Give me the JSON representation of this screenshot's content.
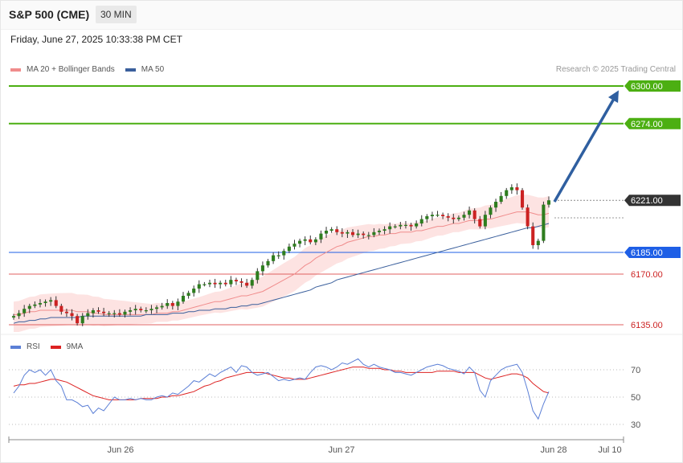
{
  "header": {
    "title": "S&P 500 (CME)",
    "interval": "30 MIN",
    "datetime": "Friday, June 27, 2025 10:33:38 PM CET"
  },
  "legend": {
    "ma20": "MA 20 + Bollinger Bands",
    "ma50": "MA 50",
    "credit": "Research © 2025 Trading Central"
  },
  "rsi_legend": {
    "rsi": "RSI",
    "ma9": "9MA"
  },
  "colors": {
    "candle_up": "#2e7d1f",
    "candle_down": "#cc2222",
    "ma20": "#f08c8c",
    "bollinger_fill": "#fde0df",
    "ma50": "#3a5f9c",
    "resistance": "#4caf12",
    "support_blue": "#1e5fe6",
    "support_red": "#e06060",
    "rsi": "#5b7fd6",
    "rsi_ma": "#dd2222",
    "arrow": "#2f5fa0"
  },
  "chart_data": [
    {
      "type": "candlestick",
      "x_labels": [
        "Jun 26",
        "Jun 27",
        "Jun 28",
        "Jul 10"
      ],
      "ylim": [
        6125,
        6315
      ],
      "levels": [
        {
          "value": 6300.0,
          "label": "6300.00",
          "kind": "resistance"
        },
        {
          "value": 6274.0,
          "label": "6274.00",
          "kind": "resistance"
        },
        {
          "value": 6221.0,
          "label": "6221.00",
          "kind": "current"
        },
        {
          "value": 6185.0,
          "label": "6185.00",
          "kind": "support"
        },
        {
          "value": 6170.0,
          "label": "6170.00",
          "kind": "support-minor"
        },
        {
          "value": 6135.0,
          "label": "6135.00",
          "kind": "support-minor"
        }
      ],
      "projection": {
        "from": 6220,
        "to": 6297
      },
      "closes": [
        6141,
        6143,
        6146,
        6148,
        6149,
        6150,
        6151,
        6152,
        6148,
        6144,
        6143,
        6141,
        6136,
        6141,
        6143,
        6145,
        6144,
        6143,
        6143,
        6143,
        6142,
        6144,
        6145,
        6146,
        6145,
        6145,
        6146,
        6147,
        6148,
        6150,
        6148,
        6151,
        6155,
        6157,
        6160,
        6163,
        6163,
        6164,
        6163,
        6164,
        6163,
        6166,
        6165,
        6164,
        6162,
        6166,
        6172,
        6176,
        6179,
        6183,
        6183,
        6186,
        6189,
        6191,
        6193,
        6194,
        6192,
        6194,
        6198,
        6200,
        6201,
        6199,
        6198,
        6199,
        6197,
        6198,
        6197,
        6197,
        6199,
        6200,
        6201,
        6203,
        6203,
        6204,
        6204,
        6203,
        6205,
        6208,
        6210,
        6211,
        6211,
        6210,
        6209,
        6208,
        6209,
        6211,
        6214,
        6208,
        6203,
        6211,
        6216,
        6220,
        6224,
        6228,
        6230,
        6228,
        6216,
        6203,
        6190,
        6193,
        6218,
        6221
      ],
      "ma20": [
        6142,
        6142,
        6143,
        6144,
        6144,
        6145,
        6145,
        6145,
        6145,
        6145,
        6145,
        6145,
        6144,
        6144,
        6144,
        6143,
        6143,
        6142,
        6142,
        6142,
        6142,
        6142,
        6142,
        6142,
        6142,
        6142,
        6142,
        6143,
        6143,
        6143,
        6144,
        6144,
        6145,
        6146,
        6147,
        6148,
        6149,
        6150,
        6151,
        6151,
        6152,
        6153,
        6154,
        6155,
        6155,
        6156,
        6157,
        6158,
        6160,
        6162,
        6164,
        6166,
        6168,
        6170,
        6173,
        6176,
        6178,
        6181,
        6183,
        6185,
        6187,
        6189,
        6190,
        6192,
        6193,
        6194,
        6195,
        6196,
        6196,
        6197,
        6197,
        6198,
        6198,
        6199,
        6199,
        6199,
        6200,
        6200,
        6201,
        6202,
        6203,
        6203,
        6204,
        6205,
        6205,
        6206,
        6207,
        6207,
        6207,
        6208,
        6208,
        6209,
        6210,
        6211,
        6212,
        6213,
        6213,
        6213,
        6212,
        6211,
        6211,
        6212
      ],
      "ma50": [
        6136,
        6137,
        6137,
        6138,
        6138,
        6139,
        6139,
        6140,
        6140,
        6140,
        6140,
        6140,
        6140,
        6141,
        6141,
        6141,
        6141,
        6141,
        6141,
        6141,
        6141,
        6141,
        6141,
        6141,
        6141,
        6142,
        6142,
        6142,
        6142,
        6142,
        6143,
        6143,
        6143,
        6144,
        6144,
        6145,
        6145,
        6145,
        6146,
        6146,
        6146,
        6147,
        6147,
        6148,
        6148,
        6149,
        6149,
        6150,
        6151,
        6152,
        6153,
        6154,
        6155,
        6156,
        6157,
        6158,
        6159,
        6161,
        6162,
        6163,
        6164,
        6166,
        6167,
        6168,
        6169,
        6170,
        6171,
        6172,
        6173,
        6174,
        6175,
        6176,
        6177,
        6178,
        6179,
        6180,
        6181,
        6182,
        6183,
        6184,
        6185,
        6186,
        6187,
        6188,
        6189,
        6190,
        6191,
        6192,
        6193,
        6194,
        6195,
        6196,
        6197,
        6198,
        6199,
        6200,
        6201,
        6202,
        6202,
        6203,
        6204,
        6205
      ]
    },
    {
      "type": "line",
      "name": "RSI",
      "x_labels": [
        "Jun 26",
        "Jun 27",
        "Jun 28",
        "Jul 10"
      ],
      "yticks": [
        70,
        50,
        30
      ],
      "rsi": [
        53,
        58,
        66,
        70,
        68,
        70,
        66,
        70,
        62,
        58,
        48,
        48,
        46,
        43,
        44,
        38,
        42,
        40,
        45,
        50,
        48,
        48,
        49,
        48,
        49,
        48,
        48,
        50,
        51,
        50,
        53,
        52,
        55,
        58,
        62,
        61,
        64,
        67,
        65,
        68,
        70,
        72,
        68,
        73,
        72,
        68,
        66,
        67,
        68,
        65,
        62,
        63,
        62,
        63,
        64,
        63,
        68,
        72,
        73,
        72,
        70,
        72,
        75,
        74,
        76,
        78,
        74,
        72,
        74,
        72,
        71,
        70,
        68,
        68,
        67,
        66,
        68,
        70,
        72,
        73,
        74,
        73,
        71,
        70,
        69,
        67,
        72,
        68,
        55,
        50,
        62,
        66,
        70,
        72,
        73,
        74,
        68,
        55,
        40,
        34,
        45,
        54
      ],
      "ma9": [
        58,
        59,
        59,
        60,
        60,
        61,
        62,
        63,
        63,
        62,
        61,
        59,
        57,
        55,
        53,
        51,
        50,
        49,
        48,
        48,
        48,
        48,
        48,
        48,
        49,
        49,
        49,
        49,
        50,
        50,
        51,
        51,
        52,
        53,
        54,
        56,
        58,
        59,
        61,
        62,
        64,
        65,
        66,
        67,
        68,
        68,
        68,
        68,
        67,
        66,
        65,
        64,
        64,
        63,
        63,
        63,
        64,
        65,
        66,
        67,
        68,
        69,
        70,
        71,
        72,
        72,
        72,
        71,
        71,
        71,
        70,
        70,
        69,
        69,
        68,
        68,
        68,
        68,
        68,
        68,
        69,
        69,
        69,
        69,
        68,
        68,
        68,
        68,
        66,
        64,
        63,
        64,
        65,
        66,
        67,
        67,
        66,
        64,
        60,
        57,
        54,
        53
      ]
    }
  ]
}
